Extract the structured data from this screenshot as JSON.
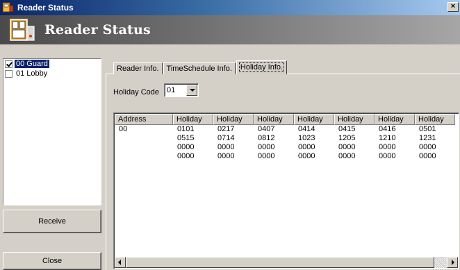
{
  "window": {
    "title": "Reader Status",
    "close_glyph": "×"
  },
  "banner": {
    "heading": "Reader Status"
  },
  "readers": [
    {
      "label": "00 Guard",
      "checked": true,
      "selected": true
    },
    {
      "label": "01 Lobby",
      "checked": false,
      "selected": false
    }
  ],
  "buttons": {
    "receive": "Receive",
    "close": "Close"
  },
  "tabs": [
    {
      "label": "Reader Info.",
      "active": false
    },
    {
      "label": "TimeSchedule Info.",
      "active": false
    },
    {
      "label": "Holiday Info.",
      "active": true
    }
  ],
  "holiday_code": {
    "label": "Holiday Code",
    "value": "01"
  },
  "table": {
    "headers": [
      "Address",
      "Holiday",
      "Holiday",
      "Holiday",
      "Holiday",
      "Holiday",
      "Holiday",
      "Holiday"
    ],
    "rows": [
      [
        "00",
        "0101",
        "0217",
        "0407",
        "0414",
        "0415",
        "0416",
        "0501"
      ],
      [
        "",
        "0515",
        "0714",
        "0812",
        "1023",
        "1205",
        "1210",
        "1231"
      ],
      [
        "",
        "0000",
        "0000",
        "0000",
        "0000",
        "0000",
        "0000",
        "0000"
      ],
      [
        "",
        "0000",
        "0000",
        "0000",
        "0000",
        "0000",
        "0000",
        "0000"
      ]
    ]
  },
  "icons": {
    "app": "reader-app-icon",
    "banner": "reader-device-icon"
  }
}
